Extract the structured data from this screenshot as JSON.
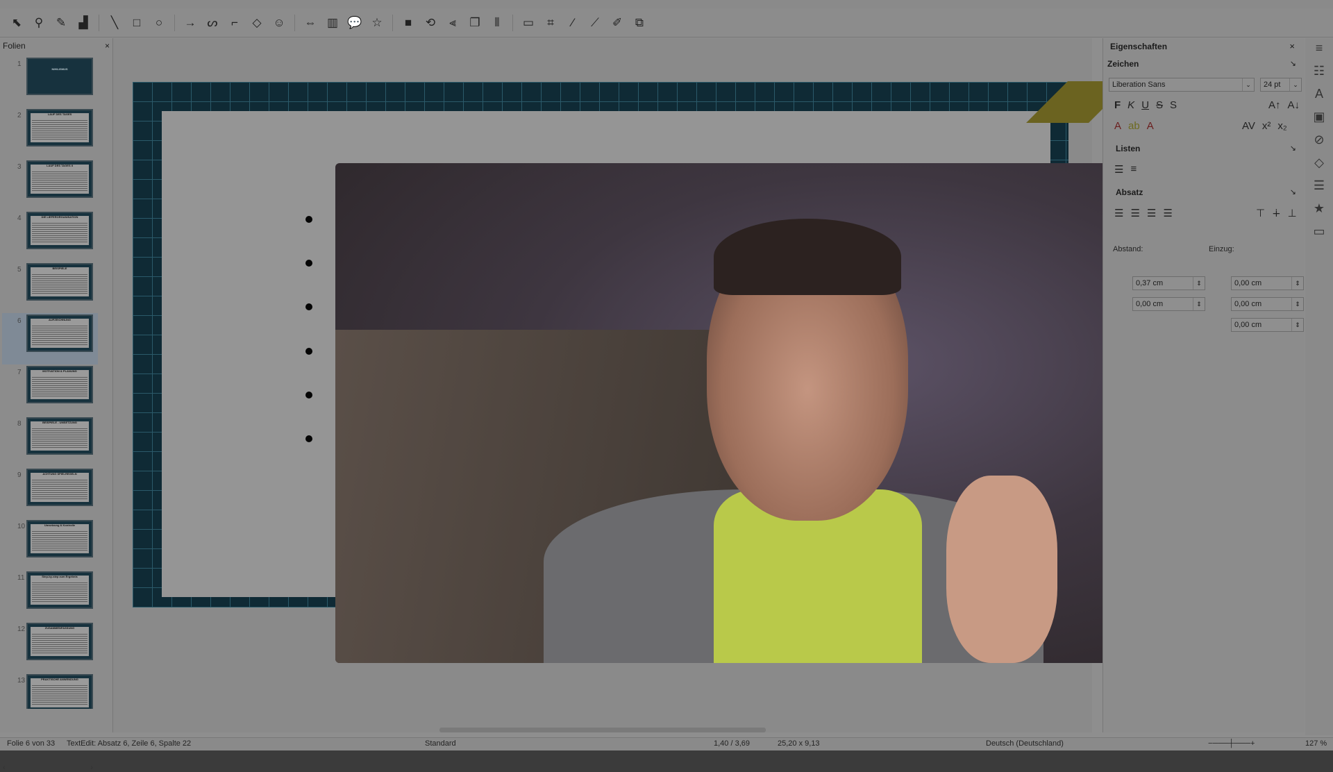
{
  "toolbar": {
    "tools": [
      {
        "name": "select-icon",
        "glyph": "⬉"
      },
      {
        "name": "zoom-pan-icon",
        "glyph": "⚲"
      },
      {
        "name": "line-color-icon",
        "glyph": "✎"
      },
      {
        "name": "fill-color-icon",
        "glyph": "▟"
      },
      {
        "name": "line-icon",
        "glyph": "╲"
      },
      {
        "name": "rectangle-icon",
        "glyph": "□"
      },
      {
        "name": "ellipse-icon",
        "glyph": "○"
      },
      {
        "name": "arrow-line-icon",
        "glyph": "→"
      },
      {
        "name": "curve-icon",
        "glyph": "ᔕ"
      },
      {
        "name": "connector-icon",
        "glyph": "⌐"
      },
      {
        "name": "basic-shapes-icon",
        "glyph": "◇"
      },
      {
        "name": "symbol-shapes-icon",
        "glyph": "☺"
      },
      {
        "name": "block-arrows-icon",
        "glyph": "⇔"
      },
      {
        "name": "flowchart-icon",
        "glyph": "▥"
      },
      {
        "name": "callout-icon",
        "glyph": "💬"
      },
      {
        "name": "star-icon",
        "glyph": "☆"
      },
      {
        "name": "3d-object-icon",
        "glyph": "■"
      },
      {
        "name": "rotate-icon",
        "glyph": "⟲"
      },
      {
        "name": "align-icon",
        "glyph": "⫷"
      },
      {
        "name": "arrange-icon",
        "glyph": "❐"
      },
      {
        "name": "distribute-icon",
        "glyph": "⫴"
      },
      {
        "name": "shadow-icon",
        "glyph": "▭"
      },
      {
        "name": "crop-icon",
        "glyph": "⌗"
      },
      {
        "name": "filter-icon",
        "glyph": "⁄"
      },
      {
        "name": "points-icon",
        "glyph": "⟋"
      },
      {
        "name": "glue-points-icon",
        "glyph": "✐"
      },
      {
        "name": "toggle-extrusion-icon",
        "glyph": "⧉"
      }
    ]
  },
  "slides_pane": {
    "title": "Folien",
    "close": "×",
    "slides": [
      {
        "num": "1",
        "title": "NIHILISMUS",
        "kind": "title"
      },
      {
        "num": "2",
        "title": "LAUF DES TAGES",
        "kind": "text"
      },
      {
        "num": "3",
        "title": "LAUF DES TAGES II",
        "kind": "text"
      },
      {
        "num": "4",
        "title": "DIE LIEFERORGANISATION",
        "kind": "text"
      },
      {
        "num": "5",
        "title": "BEISPIELE",
        "kind": "text"
      },
      {
        "num": "6",
        "title": "AUFZEICHNUNG",
        "kind": "text",
        "selected": true
      },
      {
        "num": "7",
        "title": "MOTIVATION & PLANUNG",
        "kind": "text"
      },
      {
        "num": "8",
        "title": "BEISPIELE - UMSETZUNG",
        "kind": "text"
      },
      {
        "num": "9",
        "title": "ACHTUNG SPIELREGELN",
        "kind": "text"
      },
      {
        "num": "10",
        "title": "Umsetzung & Kontrolle",
        "kind": "text"
      },
      {
        "num": "11",
        "title": "Step-by-step zum Ergebnis",
        "kind": "text"
      },
      {
        "num": "12",
        "title": "ZUSAMMENFASSUNG",
        "kind": "text"
      },
      {
        "num": "13",
        "title": "PRAKTISCHE ANWENDUNG",
        "kind": "text"
      }
    ]
  },
  "sidebar": {
    "title": "Eigenschaften",
    "close": "×",
    "menu": "≡",
    "zeichen": {
      "title": "Zeichen",
      "font_name": "Liberation Sans",
      "font_size": "24 pt",
      "format_buttons": [
        "F",
        "K",
        "U",
        "S",
        "S"
      ],
      "grow_shrink": [
        "A↑",
        "A↓"
      ],
      "color_buttons": [
        "A",
        "ab",
        "A"
      ],
      "spacing": [
        "AV",
        "x²",
        "x₂"
      ]
    },
    "listen": {
      "title": "Listen"
    },
    "absatz": {
      "title": "Absatz",
      "abstand_label": "Abstand:",
      "einzug_label": "Einzug:",
      "abstand_above": "0,37 cm",
      "abstand_below": "0,00 cm",
      "einzug_before": "0,00 cm",
      "einzug_after": "0,00 cm",
      "einzug_first": "0,00 cm"
    }
  },
  "deck_tabs": [
    "properties-icon",
    "styles-icon",
    "gallery-icon",
    "navigator-icon",
    "shapes-icon",
    "slide-transition-icon",
    "animation-icon",
    "master-slides-icon"
  ],
  "statusbar": {
    "slide": "Folie 6 von 33",
    "edit": "TextEdit: Absatz 6, Zeile 6, Spalte 22",
    "layout": "Standard",
    "position": "1,40 / 3,69",
    "size": "25,20 x 9,13",
    "language": "Deutsch (Deutschland)",
    "zoom": "127 %"
  }
}
